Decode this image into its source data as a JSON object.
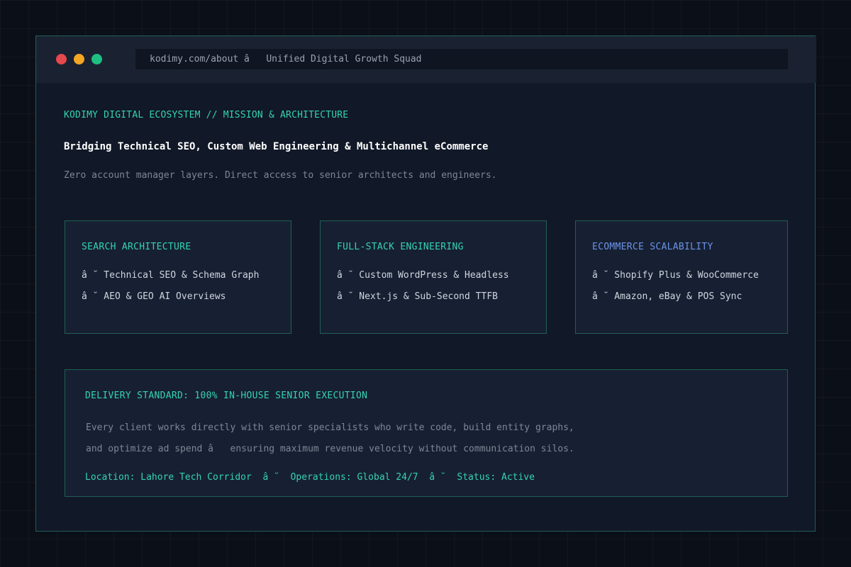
{
  "browser": {
    "url_text": "kodimy.com/about â   Unified Digital Growth Squad",
    "traffic_lights": {
      "close_color": "#e5484d",
      "minimize_color": "#f5a623",
      "maximize_color": "#1fbf83"
    }
  },
  "hero": {
    "eyebrow": "KODIMY DIGITAL ECOSYSTEM // MISSION & ARCHITECTURE",
    "headline": "Bridging Technical SEO, Custom Web Engineering & Multichannel eCommerce",
    "subline": "Zero account manager layers. Direct access to senior architects and engineers."
  },
  "cards": [
    {
      "title": "SEARCH ARCHITECTURE",
      "title_color": "#34d3b0",
      "items": [
        "â ˘ Technical SEO & Schema Graph",
        "â ˘ AEO & GEO AI Overviews"
      ]
    },
    {
      "title": "FULL-STACK ENGINEERING",
      "title_color": "#34d3b0",
      "items": [
        "â ˘ Custom WordPress & Headless",
        "â ˘ Next.js & Sub-Second TTFB"
      ]
    },
    {
      "title": "ECOMMERCE SCALABILITY",
      "title_color": "#6b93e8",
      "items": [
        "â ˘ Shopify Plus & WooCommerce",
        "â ˘ Amazon, eBay & POS Sync"
      ]
    }
  ],
  "delivery": {
    "title": "DELIVERY STANDARD: 100% IN-HOUSE SENIOR EXECUTION",
    "lines": [
      "Every client works directly with senior specialists who write code, build entity graphs,",
      "and optimize ad spend â   ensuring maximum revenue velocity without communication silos."
    ],
    "meta": "Location: Lahore Tech Corridor  â ˘  Operations: Global 24/7  â ˘  Status: Active"
  },
  "theme": {
    "accent": "#34d3b0",
    "accent_blue": "#6b93e8",
    "background": "#0b0f17",
    "panel": "#111827",
    "card": "#172032",
    "border": "#1f5f56"
  }
}
